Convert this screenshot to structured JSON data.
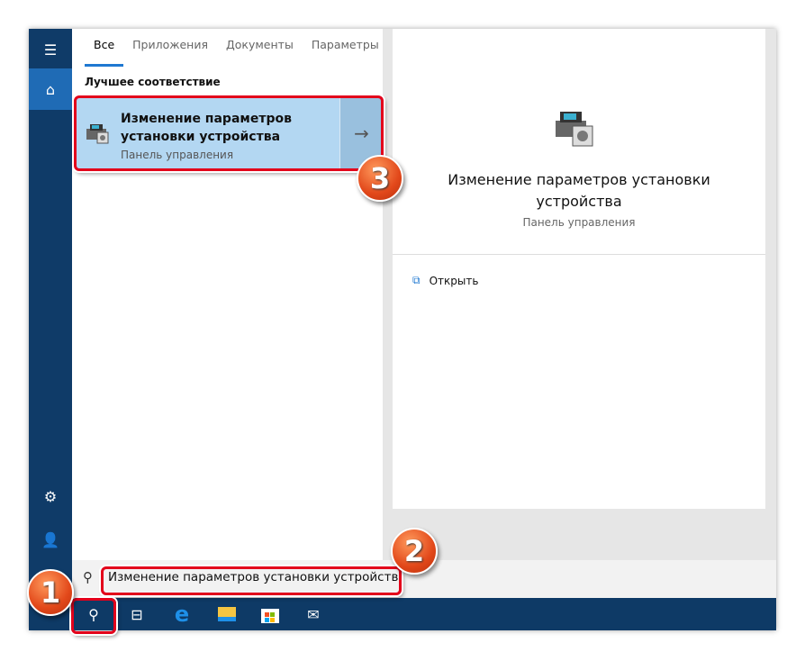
{
  "tabs": [
    {
      "label": "Все"
    },
    {
      "label": "Приложения"
    },
    {
      "label": "Документы"
    },
    {
      "label": "Параметры"
    }
  ],
  "best_match": {
    "header": "Лучшее соответствие",
    "title_line1": "Изменение параметров",
    "title_line2": "установки устройства",
    "subtitle": "Панель управления",
    "icon": "device-installation-icon",
    "arrow": "→"
  },
  "preview": {
    "title": "Изменение параметров установки устройства",
    "subtitle": "Панель управления",
    "open_label": "Открыть"
  },
  "search": {
    "value": "Изменение параметров установки устройства"
  },
  "sidebar": {
    "icons": [
      "hamburger-icon",
      "home-icon",
      "settings-icon",
      "feedback-icon"
    ]
  },
  "taskbar": {
    "icons": [
      "search-icon",
      "task-view-icon",
      "edge-icon",
      "file-explorer-icon",
      "store-icon",
      "mail-icon"
    ]
  },
  "annotations": {
    "step1": "1",
    "step2": "2",
    "step3": "3"
  },
  "colors": {
    "sidebar": "#0f3b68",
    "accent": "#1f78d1",
    "highlight": "#b3d7f2",
    "annotation": "#e3001b"
  }
}
